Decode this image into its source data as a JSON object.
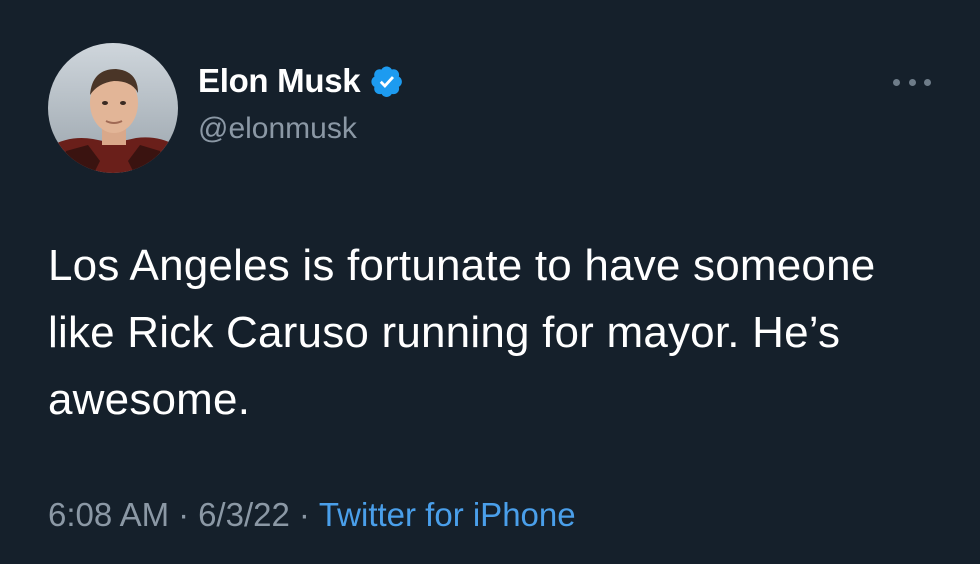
{
  "author": {
    "display_name": "Elon Musk",
    "handle": "@elonmusk",
    "verified": true,
    "verified_color": "#1d9bf0"
  },
  "tweet": {
    "text": "Los Angeles is fortunate to have someone like Rick Caruso running for mayor. He’s awesome."
  },
  "meta": {
    "time": "6:08 AM",
    "separator_1": "·",
    "date": "6/3/22",
    "separator_2": "·",
    "source": "Twitter for iPhone"
  },
  "icons": {
    "more": "more-options-icon",
    "verified": "verified-badge-icon"
  },
  "theme": {
    "background": "#15202b",
    "text_primary": "#ffffff",
    "text_secondary": "#8b98a5",
    "link": "#4a9fea"
  }
}
